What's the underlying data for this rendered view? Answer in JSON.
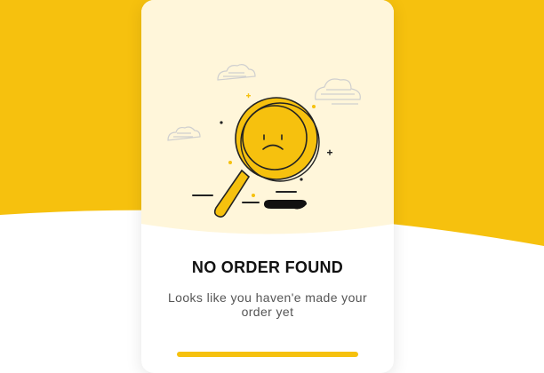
{
  "empty_state": {
    "title": "NO ORDER FOUND",
    "message": "Looks like you haven'e made your order yet"
  },
  "icons": {
    "illustration": "magnifier-sad-face-icon",
    "cloud": "cloud-icon"
  },
  "colors": {
    "accent": "#F6C10E",
    "card_top": "#FFF6DA",
    "text": "#111111",
    "muted": "#555555"
  }
}
